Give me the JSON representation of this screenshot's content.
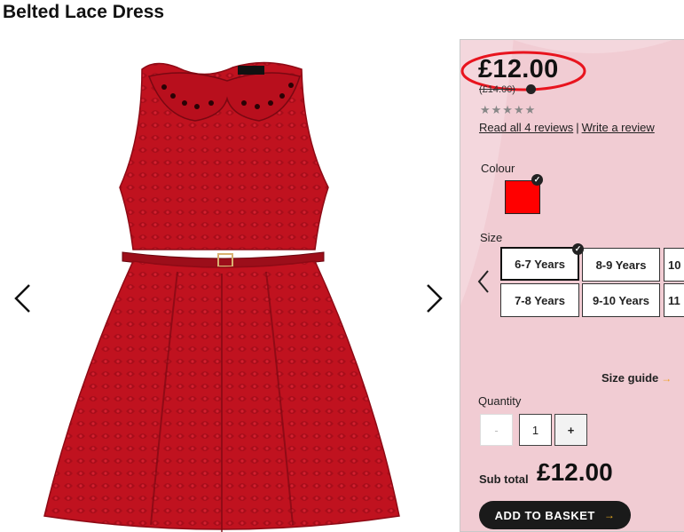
{
  "product": {
    "title": "Belted Lace Dress",
    "price": "£12.00",
    "was_price": "(£14.00)",
    "rating_stars": "★★★★★",
    "read_reviews": "Read all 4 reviews",
    "separator": "|",
    "write_review": "Write a review"
  },
  "colour": {
    "label": "Colour",
    "selected_hex": "#ff0000",
    "check_glyph": "✓"
  },
  "size": {
    "label": "Size",
    "options": [
      "6-7 Years",
      "8-9 Years",
      "10",
      "7-8 Years",
      "9-10 Years",
      "11"
    ],
    "selected": "6-7 Years",
    "guide": "Size guide",
    "guide_arrow": "→"
  },
  "quantity": {
    "label": "Quantity",
    "minus": "-",
    "value": "1",
    "plus": "+"
  },
  "subtotal": {
    "label": "Sub total",
    "value": "£12.00"
  },
  "basket": {
    "label": "ADD TO BASKET",
    "arrow": "→"
  },
  "colors": {
    "dress": "#c0121f",
    "panel_tint": "#f5dde2",
    "highlight_circle": "#e8141e",
    "button": "#1a1a1a"
  },
  "icons": {
    "prev": "chevron-left-icon",
    "next": "chevron-right-icon",
    "check": "check-icon",
    "info": "info-icon"
  }
}
